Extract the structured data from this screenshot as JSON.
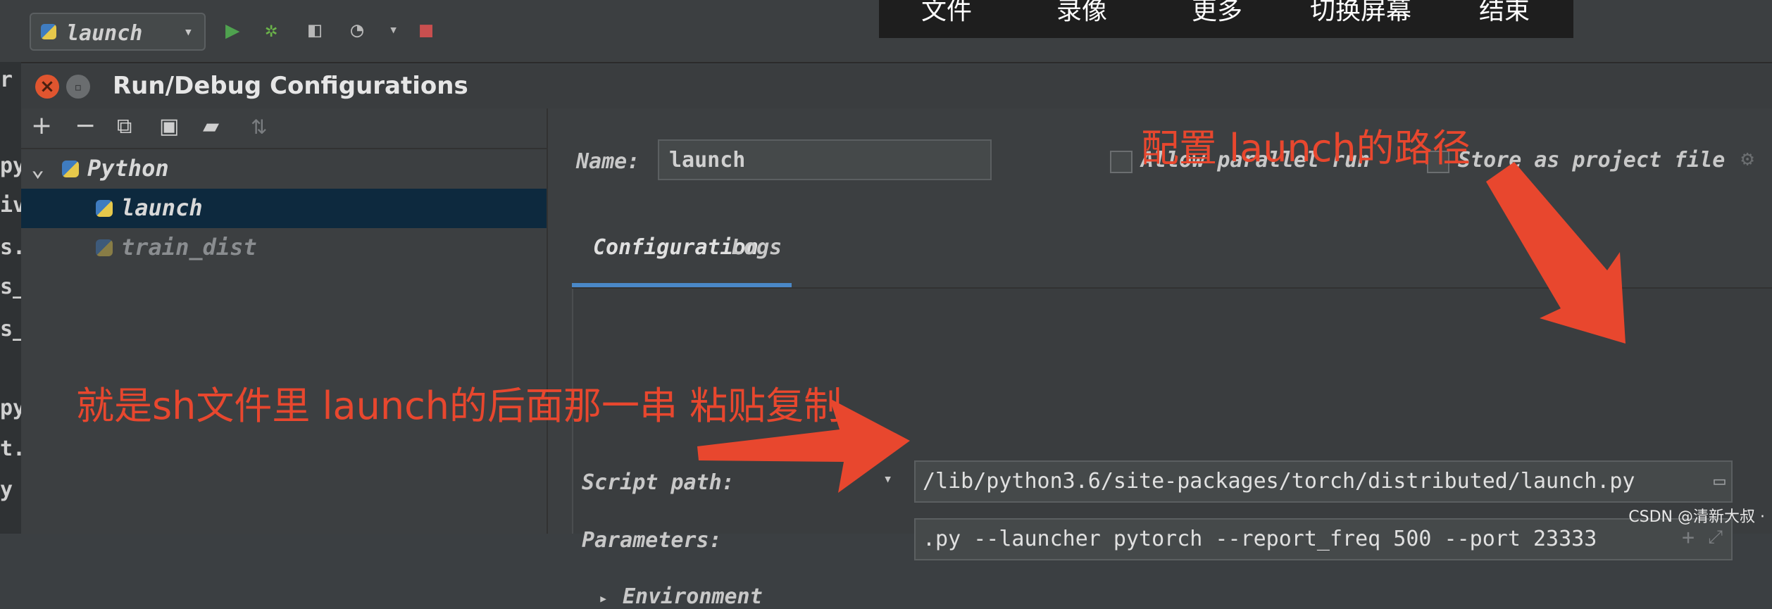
{
  "toolbar": {
    "run_config": "launch",
    "icons": [
      "run-icon",
      "debug-icon",
      "coverage-icon",
      "profile-icon",
      "stop-icon"
    ]
  },
  "recording_bar": {
    "items": [
      "文件",
      "录像",
      "更多",
      "切换屏幕",
      "结束"
    ]
  },
  "editor_strip": [
    "r",
    "py",
    "iv",
    "s.",
    "s_",
    "s_",
    "py",
    "t.",
    "y"
  ],
  "dialog": {
    "title": "Run/Debug Configurations",
    "tree": {
      "group": "Python",
      "items": [
        "launch",
        "train_dist"
      ],
      "selected": "launch"
    },
    "name_label": "Name:",
    "name_value": "launch",
    "allow_parallel_run": {
      "label": "Allow parallel run",
      "checked": false
    },
    "store_as_project_file": {
      "label": "Store as project file",
      "checked": false
    },
    "tabs": [
      "Configuration",
      "Logs"
    ],
    "active_tab": "Configuration",
    "script_path_label": "Script path:",
    "script_path_value": "/lib/python3.6/site-packages/torch/distributed/launch.py",
    "parameters_label": "Parameters:",
    "parameters_value": ".py --launcher pytorch --report_freq 500 --port 23333",
    "environment_label": "Environment"
  },
  "annotations": {
    "top": "配置 launch的路径",
    "left": "就是sh文件里 launch的后面那一串 粘贴复制",
    "color": "#e8472e"
  },
  "watermark": "CSDN @清新大叔 ·"
}
